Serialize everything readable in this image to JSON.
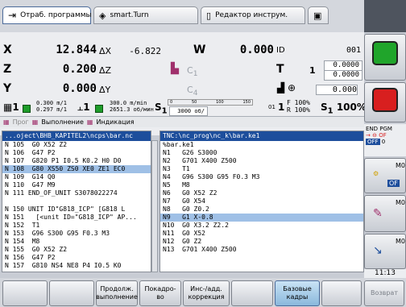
{
  "tabs": {
    "program_run": "Отраб. программы",
    "smart_turn": "smart.Turn",
    "tool_editor": "Редактор инструм."
  },
  "positions": {
    "x_label": "X",
    "x_value": "12.844",
    "dx_label": "ΔX",
    "dx_value": "-6.822",
    "w_label": "W",
    "w_value": "0.000",
    "id_label": "ID",
    "id_value": "001",
    "z_label": "Z",
    "z_value": "0.200",
    "dz_label": "ΔZ",
    "c1_label": "C",
    "c1_sub": "1",
    "t_label": "T",
    "t_value": "1",
    "t_off_x": "0.0000",
    "t_off_z": "0.0000",
    "y_label": "Y",
    "y_value": "0.000",
    "dy_label": "ΔY",
    "c4_label": "C",
    "c4_sub": "4",
    "c4_value": "0.000"
  },
  "status": {
    "chan": "1",
    "feed_top": "0.300 m/1",
    "feed_bot": "0.297 m/1",
    "spindle_num": "1",
    "speed_top": "300.0 m/min",
    "speed_bot": "2651.3 об/мин",
    "s1": "S",
    "s1_sub": "1",
    "scale": [
      "0",
      "50",
      "100",
      "150"
    ],
    "rpm": "3000 об/мин",
    "f_pct": "100%",
    "r_pct": "100%",
    "s_total": "S",
    "s_total_sub": "1",
    "s_pct": "100%",
    "num_01": "01",
    "num_1": "1"
  },
  "toolbar": {
    "prog": "Прог",
    "exec": "Выполнение",
    "indic": "Индикация"
  },
  "left_panel": {
    "header": "...oject\\BHB_KAPITEL2\\ncps\\bar.nc",
    "lines": [
      "N 105  G0 X52 Z2",
      "N 106  G47 P2",
      "N 107  G820 P1 I0.5 K0.2 H0 D0",
      "N 108  G80 XS50 ZS0 XE0 ZE1 EC0",
      "N 109  G14 Q0",
      "N 110  G47 M9",
      "N 111 END_OF_UNIT S3078022274",
      "",
      "N 150 UNIT ID\"G818_ICP\" [G818 L",
      "N 151   [<unit ID=\"G818_ICP\" AP...",
      "N 152  T1",
      "N 153  G96 S300 G95 F0.3 M3",
      "N 154  M8",
      "N 155  G0 X52 Z2",
      "N 156  G47 P2",
      "N 157  G810 NS4 NE8 P4 I0.5 K0"
    ],
    "selected": 3
  },
  "right_panel": {
    "header": "TNC:\\nc_prog\\nc_k\\bar.ke1",
    "lines": [
      "%bar.ke1",
      "N1   G26 S3000",
      "N2   G701 X400 Z500",
      "N3   T1",
      "N4   G96 S300 G95 F0.3 M3",
      "N5   M8",
      "N6   G0 X52 Z2",
      "N7   G0 X54",
      "N8   G0 Z0.2",
      "N9   G1 X-0.8",
      "N10  G0 X3.2 Z2.2",
      "N11  G0 X52",
      "N12  G0 Z2",
      "N13  G701 X400 Z500"
    ],
    "selected": 9
  },
  "side": {
    "end_pgm": "END PGM",
    "of": "OF",
    "off": "OFF",
    "zero": "0",
    "m0a": "M0",
    "off2": "OF",
    "m0b": "M0",
    "m0c": "M0",
    "time": "11:13"
  },
  "softkeys": {
    "continue": "Продолж.\nвыполнение",
    "block": "Покадро-\nво",
    "tool_corr": "Инс-/адд.\nкоррекция",
    "base_blocks": "Базовые\nкадры",
    "back": "Возврат"
  }
}
